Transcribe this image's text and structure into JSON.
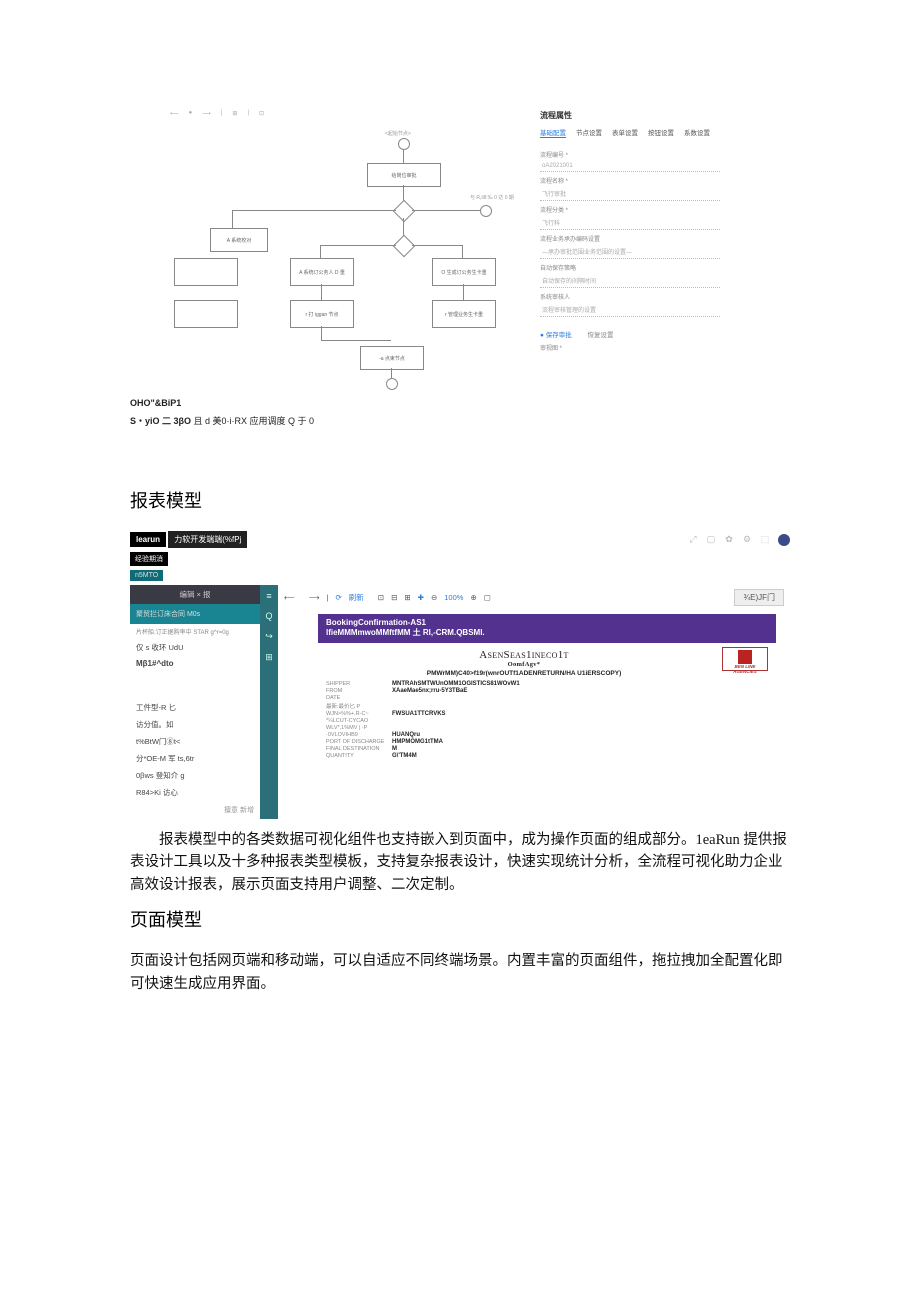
{
  "flow": {
    "toolbar": [
      "⟵",
      "●",
      "⟶",
      "|",
      "⊞",
      "|",
      "⊡"
    ],
    "nodes": {
      "start_label": "<起始节点>",
      "task1": "给岗位审批",
      "gateway_right_label": "与 R,il8:‰ 0 达 0 期",
      "task_left": "A 系统校对",
      "task2": "A 系统订公务人 D 重",
      "task3": "O 生成订公务生卡重",
      "task4": "r 打 iggan 节点",
      "task5": "r 管理业务生卡重",
      "task6": "-a 点束节点"
    },
    "props_title": "流程属性",
    "tabs": [
      "基础配置",
      "节点设置",
      "表单设置",
      "按钮设置",
      "系数设置"
    ],
    "fields": [
      {
        "label": "流程编号 *",
        "value": "oA2021001"
      },
      {
        "label": "流程名称 *",
        "value": "飞行审批"
      },
      {
        "label": "流程分类 *",
        "value": "飞行科"
      },
      {
        "label": "流程业务承办编码设置",
        "value": "—承办审批范围业务范围的设置—"
      },
      {
        "label": "自动保存策略",
        "value": "自动保存的间隔时间"
      },
      {
        "label": "系统审核人",
        "value": "流程审核管理的设置"
      }
    ],
    "ok": "● 保存审批",
    "cancel": "恢复设置",
    "bottom": "审视图 *"
  },
  "ocr_flow_1": "OHO\"&BiP1",
  "ocr_flow_2a": "S・yiO 二 3βO",
  "ocr_flow_2b": " 且 d 美0·i·RX 应用调度 Q 于 0",
  "heading_report": "报表模型",
  "reporter": {
    "brand": "learun",
    "brand_sub": "力软开发端端(%fPj",
    "right_icons": [
      "⤢",
      "▢",
      "✿",
      "⚙",
      "⬚"
    ],
    "pill_black": "经验期消",
    "pill_teal": "n5MTO",
    "side": {
      "header": "编辑 × 报",
      "active": "聚贸拦订床合同 M0s",
      "active_sub": "片杯船:订正据购率中 STAR g^r=0g",
      "items": [
        "仅 s 收环 UdU",
        "Mβ1#^dto",
        "",
        "工件型-R 匕",
        "访分值。如",
        "t%BtW门⑧t<",
        "分*OE-M 军 ts,6tr",
        "0βws 登知介 g",
        "R84>Ki 访心"
      ],
      "bottom": "擅意 新增"
    },
    "iconcol": [
      "≡",
      "Q",
      "↪",
      "⊞"
    ],
    "toolbar": {
      "items": [
        "⟵",
        "",
        "⟶",
        "|",
        "⟳",
        "刷新",
        "",
        "⊡",
        "⊟",
        "⊞",
        "✚",
        "⊖"
      ],
      "zoom": "100%",
      "zoom_icons": [
        "⊕",
        "▢"
      ],
      "right_btn": "¾E)JF门"
    },
    "doc": {
      "title1": "BookingConfirmation-AS1",
      "title2": "lfieMMMmwoMMftfMM 土 RI,-CRM.QBSMl.",
      "heading_big": "AsenSeas1ineco1t",
      "heading_small": "OomfAgv*",
      "logo_text": "BEN LINE AGENCIES",
      "sub": "PMWrMM)C40>f19r(wnrOUTf1ADENRETURN/HA U1iERSCOPY)",
      "rows": [
        {
          "lab": "SHIPPER",
          "val": "MNTRAhSMTWUnOMM1OGISTICS81WOvW1"
        },
        {
          "lab": "FROM",
          "val": "XAaeMae5nx;rru-5Y3TBaE"
        },
        {
          "lab": "DATE",
          "val": ""
        },
        {
          "lab": "最新:最价匕 P",
          "val": ""
        },
        {
          "lab": "wjn>%%+,R-C~",
          "val": "FWSUA1TTCRVKS"
        },
        {
          "lab": "*¼lCUt-CYCao",
          "val": ""
        },
        {
          "lab": "wlv*,1%Mv | ·P",
          "val": ""
        },
        {
          "lab": "·0vlOvihB9",
          "val": "HUANQru"
        },
        {
          "lab": "Port of Discharge",
          "val": "HMPMOMG1tTMA"
        },
        {
          "lab": "Final Destination",
          "val": "M"
        },
        {
          "lab": "Quantity",
          "val": "G\\'TM4M"
        }
      ]
    }
  },
  "para_report": "　　报表模型中的各类数据可视化组件也支持嵌入到页面中，成为操作页面的组成部分。1eaRun 提供报表设计工具以及十多种报表类型模板，支持复杂报表设计，快速实现统计分析，全流程可视化助力企业高效设计报表，展示页面支持用户调整、二次定制。",
  "heading_page": "页面模型",
  "para_page": "页面设计包括网页端和移动端，可以自适应不同终端场景。内置丰富的页面组件，拖拉拽加全配置化即可快速生成应用界面。"
}
